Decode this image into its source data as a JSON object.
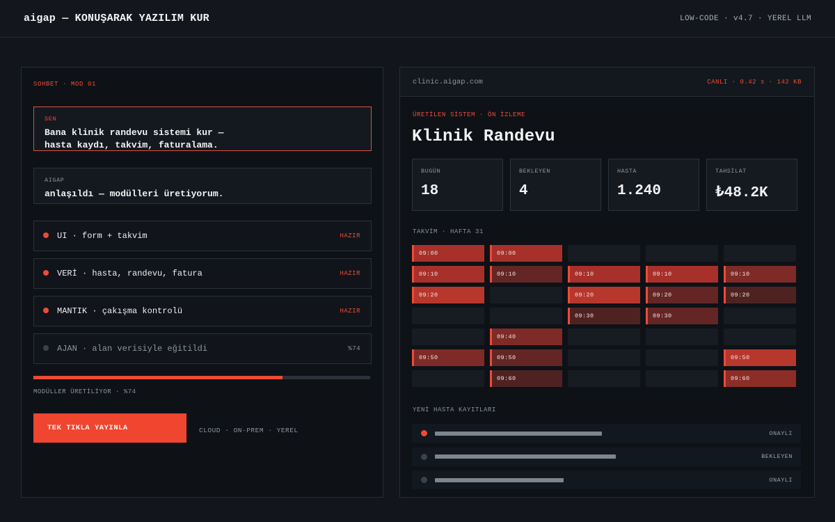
{
  "header": {
    "brand": "aigap — KONUŞARAK YAZILIM KUR",
    "version": "LOW-CODE · v4.7 · YEREL LLM"
  },
  "chat": {
    "label": "SOHBET · MOD 01",
    "user_msg": {
      "who": "SEN",
      "line1": "Bana klinik randevu sistemi kur —",
      "line2": "hasta kaydı, takvim, faturalama."
    },
    "ai_msg": {
      "who": "AIGAP",
      "text": "anlaşıldı — modülleri üretiyorum."
    },
    "modules": [
      {
        "text": "UI · form + takvim",
        "status": "HAZIR",
        "active": true
      },
      {
        "text": "VERİ · hasta, randevu, fatura",
        "status": "HAZIR",
        "active": true
      },
      {
        "text": "MANTIK · çakışma kontrolü",
        "status": "HAZIR",
        "active": true
      },
      {
        "text": "AJAN · alan verisiyle eğitildi",
        "status": "%74",
        "active": false
      }
    ],
    "progress_fraction": 0.74,
    "progress_label": "MODÜLLER ÜRETİLİYOR · %74",
    "publish_button": "TEK TIKLA YAYINLA",
    "deploy_options": "CLOUD · ON-PREM · YEREL"
  },
  "preview": {
    "url": "clinic.aigap.com",
    "live": "CANLI · 0.42 s · 142 KB",
    "label": "ÜRETİLEN SİSTEM · ÖN İZLEME",
    "title": "Klinik Randevu",
    "stats": [
      {
        "label": "BUGÜN",
        "value": "18"
      },
      {
        "label": "BEKLEYEN",
        "value": "4"
      },
      {
        "label": "HASTA",
        "value": "1.240"
      },
      {
        "label": "TAHSİLAT",
        "value": "₺48.2K"
      }
    ],
    "calendar_label": "TAKVİM · HAFTA 31",
    "calendar_rows": [
      [
        {
          "t": "09:00",
          "c": "#a8302a"
        },
        {
          "t": "09:00",
          "c": "#a8302a"
        },
        null,
        null,
        null
      ],
      [
        {
          "t": "09:10",
          "c": "#a8302a"
        },
        {
          "t": "09:10",
          "c": "#632624"
        },
        {
          "t": "09:10",
          "c": "#a8302a"
        },
        {
          "t": "09:10",
          "c": "#a8302a"
        },
        {
          "t": "09:10",
          "c": "#7e2a26"
        }
      ],
      [
        {
          "t": "09:20",
          "c": "#b8372c"
        },
        null,
        {
          "t": "09:20",
          "c": "#b8372c"
        },
        {
          "t": "09:20",
          "c": "#632624"
        },
        {
          "t": "09:20",
          "c": "#4f2222"
        }
      ],
      [
        null,
        null,
        {
          "t": "09:30",
          "c": "#4f2222"
        },
        {
          "t": "09:30",
          "c": "#632624"
        },
        null
      ],
      [
        null,
        {
          "t": "09:40",
          "c": "#7e2a26"
        },
        null,
        null,
        null
      ],
      [
        {
          "t": "09:50",
          "c": "#7e2a26"
        },
        {
          "t": "09:50",
          "c": "#632624"
        },
        null,
        null,
        {
          "t": "09:50",
          "c": "#b8372c"
        }
      ],
      [
        null,
        {
          "t": "09:60",
          "c": "#4f2222"
        },
        null,
        null,
        {
          "t": "09:60",
          "c": "#8c2d28"
        }
      ]
    ],
    "new_patients_label": "YENİ HASTA KAYITLARI",
    "patients": [
      {
        "status": "ONAYLI",
        "dot": "#ef4a35",
        "bar": 0.48
      },
      {
        "status": "BEKLEYEN",
        "dot": "#3a424c",
        "bar": 0.52
      },
      {
        "status": "ONAYLI",
        "dot": "#3a424c",
        "bar": 0.37
      }
    ]
  }
}
